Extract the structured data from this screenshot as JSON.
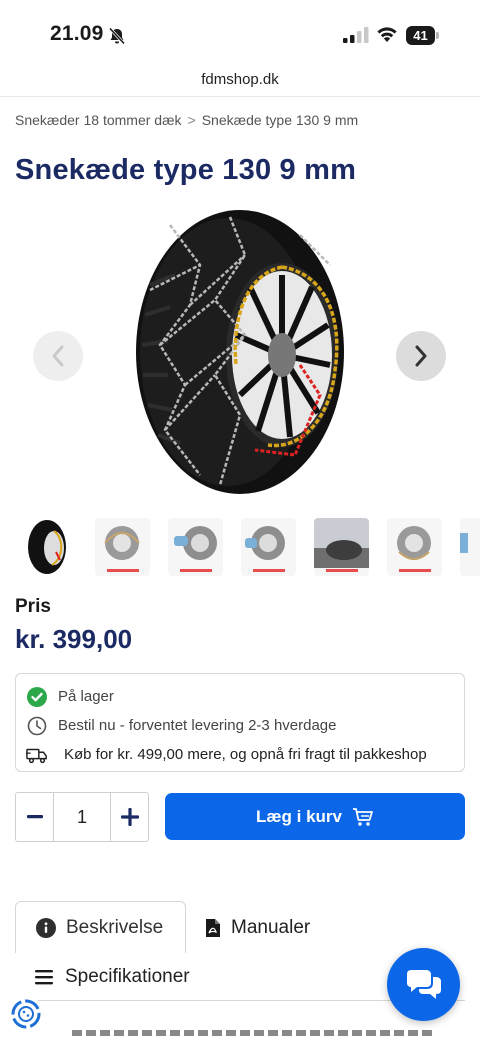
{
  "status_bar": {
    "time": "21.09",
    "battery": "41"
  },
  "browser": {
    "url": "fdmshop.dk"
  },
  "breadcrumb": {
    "items": [
      "Snekæder 18 tommer dæk",
      "Snekæde type 130 9 mm"
    ],
    "separator": ">"
  },
  "product": {
    "title": "Snekæde type 130 9 mm",
    "price_label": "Pris",
    "price": "kr. 399,00"
  },
  "gallery": {
    "main_image": "tire-with-snow-chain",
    "thumbnail_count": 7,
    "prev_icon": "chevron-left-icon",
    "next_icon": "chevron-right-icon"
  },
  "availability": {
    "stock": "På lager",
    "delivery": "Bestil nu - forventet levering 2-3 hverdage",
    "freight": "Køb for kr. 499,00 mere, og opnå fri fragt til pakkeshop"
  },
  "purchase": {
    "quantity": "1",
    "add_to_cart": "Læg i kurv"
  },
  "tabs": {
    "description": "Beskrivelse",
    "manuals": "Manualer",
    "specifications": "Specifikationer"
  },
  "colors": {
    "brand_navy": "#1b2a63",
    "primary_blue": "#0b67e8",
    "in_stock_green": "#2ba84a"
  }
}
